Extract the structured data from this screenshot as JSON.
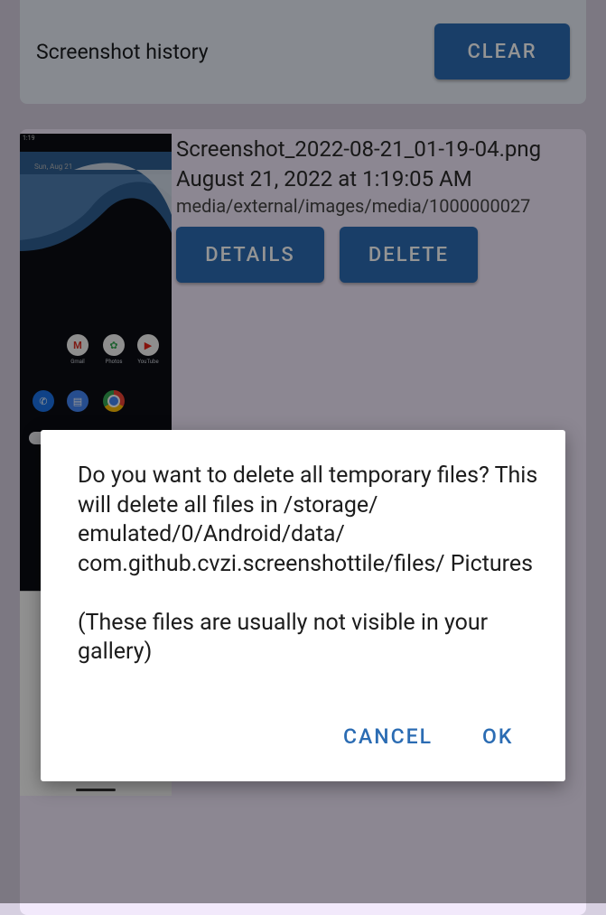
{
  "header": {
    "title": "Screenshot history",
    "clear_label": "CLEAR"
  },
  "item": {
    "file_name": "Screenshot_2022-08-21_01-19-04.png",
    "date": "August 21, 2022 at 1:19:05 AM",
    "uri": "media/external/images/media/1000000027",
    "details_label": "DETAILS",
    "delete_label": "DELETE"
  },
  "thumbnail": {
    "status_time": "1:19",
    "date_text": "Sun, Aug 21",
    "apps": [
      "Gmail",
      "Photos",
      "YouTube"
    ]
  },
  "dialog": {
    "message": "Do you want to delete all temporary files? This will delete all files in /storage/ emulated/0/Android/data/ com.github.cvzi.screenshottile/files/ Pictures\n\n(These files are usually not visible in your gallery)",
    "cancel_label": "CANCEL",
    "ok_label": "OK"
  },
  "colors": {
    "accent": "#2b6cb3",
    "card": "#f2e9fb",
    "header_card": "#e8eef8"
  },
  "icons": [
    "gmail-icon",
    "photos-icon",
    "youtube-icon",
    "phone-icon",
    "messages-icon",
    "chrome-icon"
  ]
}
